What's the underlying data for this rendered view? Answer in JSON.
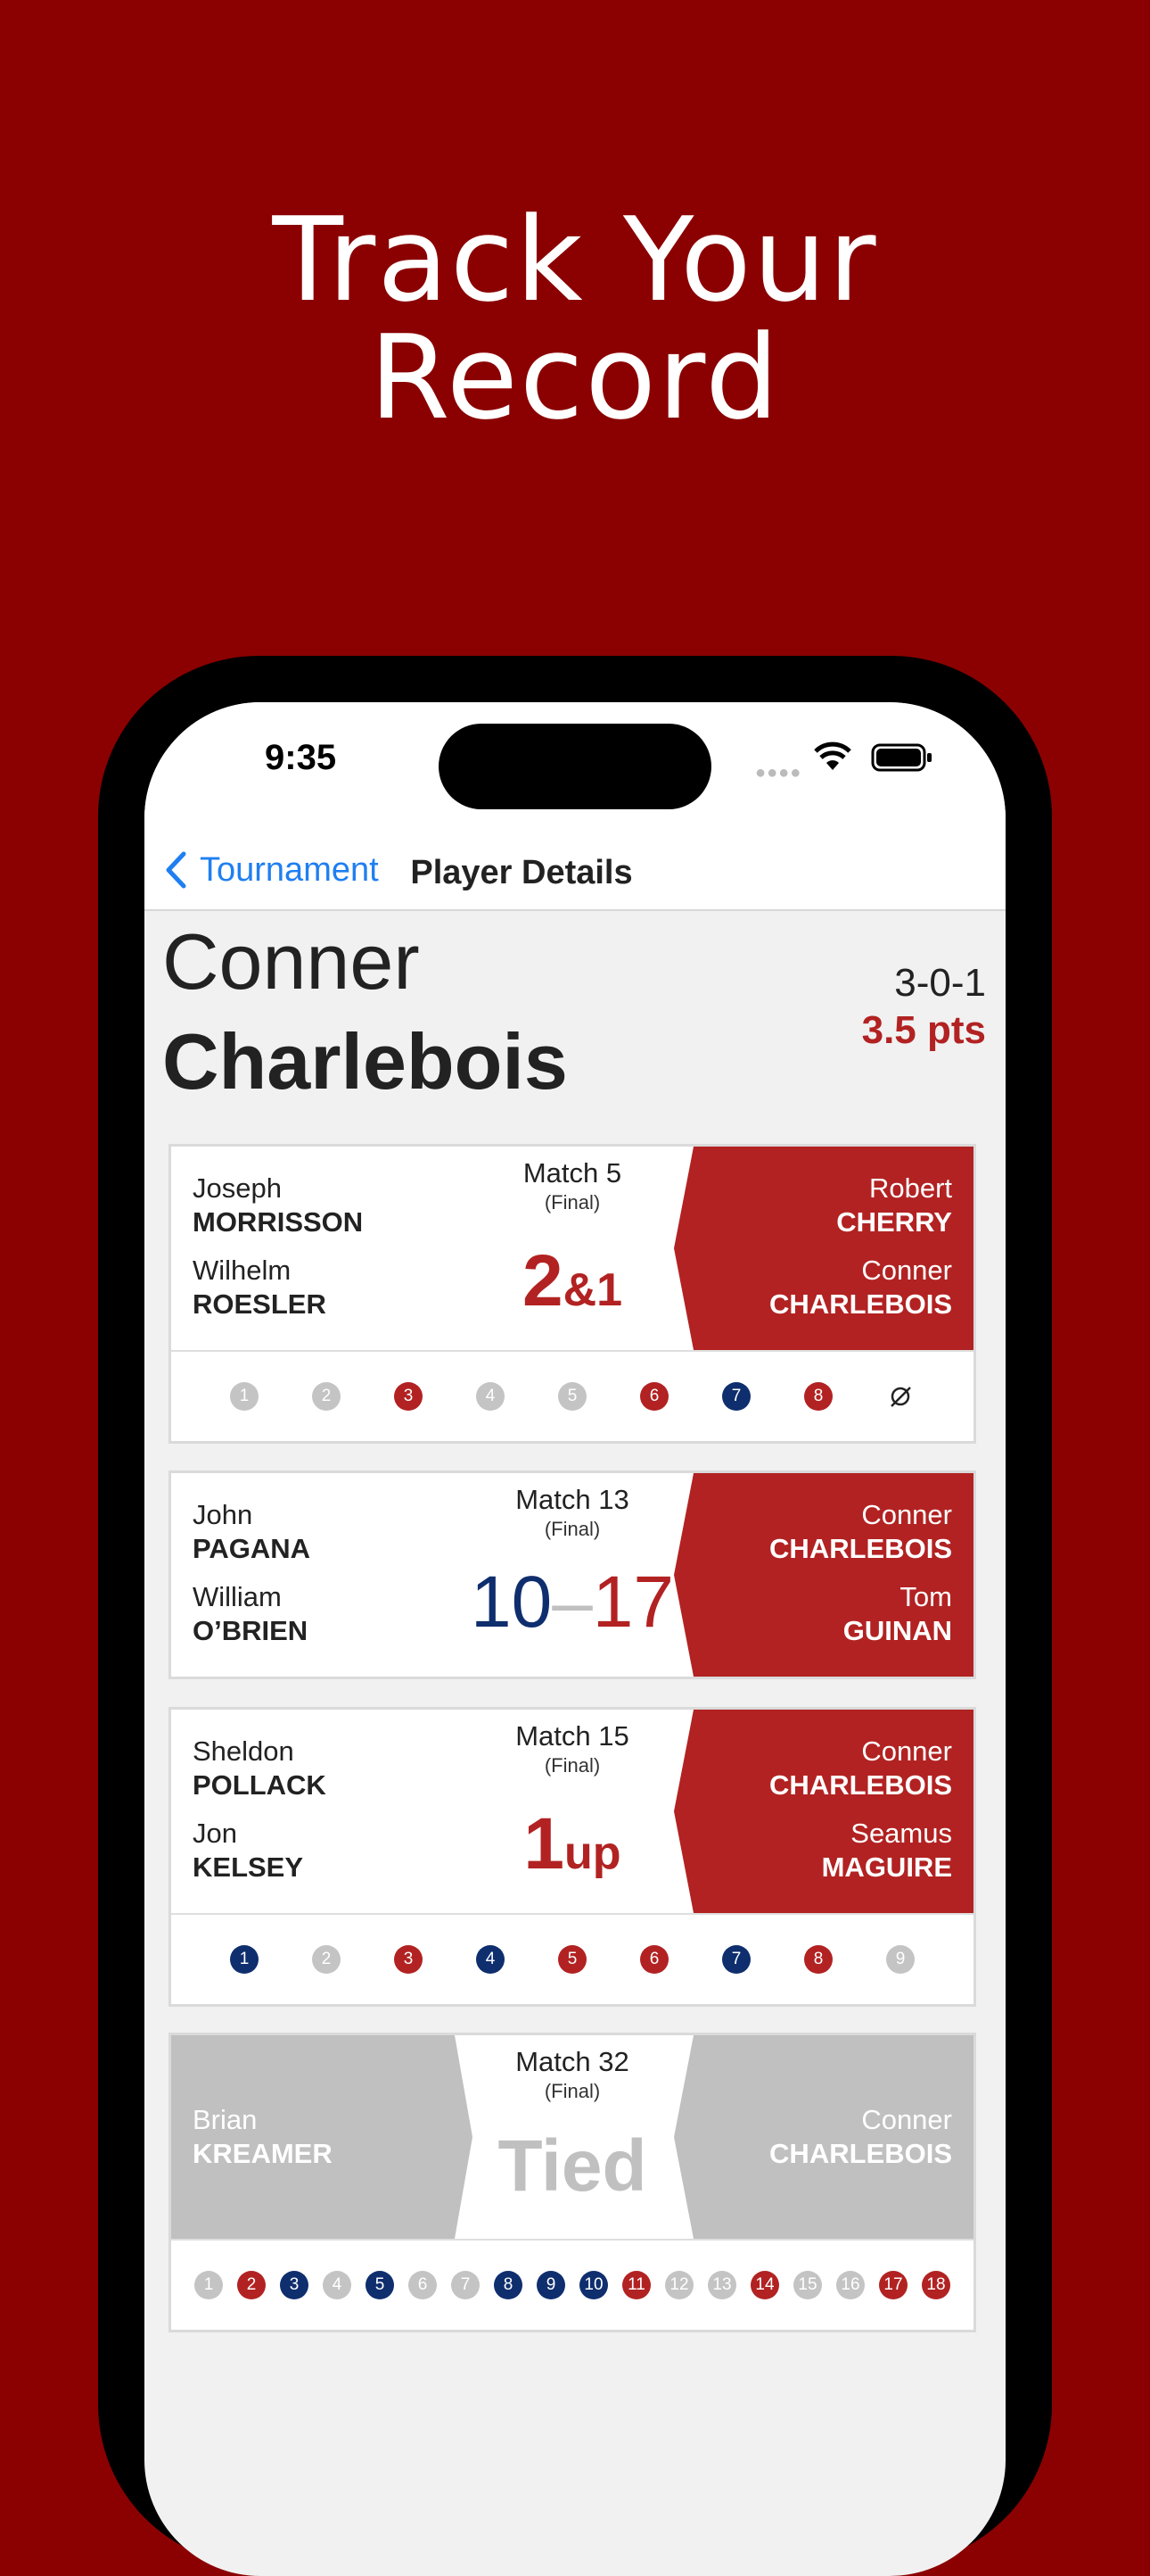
{
  "headline": {
    "line1": "Track Your",
    "line2": "Record"
  },
  "status_bar": {
    "time": "9:35"
  },
  "nav": {
    "back_label": "Tournament",
    "title": "Player Details"
  },
  "player": {
    "first_name": "Conner",
    "last_name": "Charlebois",
    "record": "3-0-1",
    "points": "3.5 pts"
  },
  "colors": {
    "background": "#8b0101",
    "red": "#b22222",
    "navy": "#0f2e6e",
    "gray": "#c0c0c0",
    "link": "#1f7ff1"
  },
  "matches": [
    {
      "title": "Match 5",
      "status": "(Final)",
      "result_main": "2",
      "result_sub": "&1",
      "left_players": [
        {
          "first": "Joseph",
          "last": "MORRISSON"
        },
        {
          "first": "Wilhelm",
          "last": "ROESLER"
        }
      ],
      "right_players": [
        {
          "first": "Robert",
          "last": "CHERRY"
        },
        {
          "first": "Conner",
          "last": "CHARLEBOIS"
        }
      ],
      "holes": [
        {
          "n": "1",
          "c": "gray"
        },
        {
          "n": "2",
          "c": "gray"
        },
        {
          "n": "3",
          "c": "red"
        },
        {
          "n": "4",
          "c": "gray"
        },
        {
          "n": "5",
          "c": "gray"
        },
        {
          "n": "6",
          "c": "red"
        },
        {
          "n": "7",
          "c": "blue"
        },
        {
          "n": "8",
          "c": "red"
        },
        {
          "n": "9",
          "c": "none",
          "icon": "not-played-icon"
        }
      ]
    },
    {
      "title": "Match 13",
      "status": "(Final)",
      "score_left": "10",
      "score_sep": "–",
      "score_right": "17",
      "left_players": [
        {
          "first": "John",
          "last": "PAGANA"
        },
        {
          "first": "William",
          "last": "O’BRIEN"
        }
      ],
      "right_players": [
        {
          "first": "Conner",
          "last": "CHARLEBOIS"
        },
        {
          "first": "Tom",
          "last": "GUINAN"
        }
      ]
    },
    {
      "title": "Match 15",
      "status": "(Final)",
      "result_main": "1",
      "result_sub": "up",
      "left_players": [
        {
          "first": "Sheldon",
          "last": "POLLACK"
        },
        {
          "first": "Jon",
          "last": "KELSEY"
        }
      ],
      "right_players": [
        {
          "first": "Conner",
          "last": "CHARLEBOIS"
        },
        {
          "first": "Seamus",
          "last": "MAGUIRE"
        }
      ],
      "holes": [
        {
          "n": "1",
          "c": "blue"
        },
        {
          "n": "2",
          "c": "gray"
        },
        {
          "n": "3",
          "c": "red"
        },
        {
          "n": "4",
          "c": "blue"
        },
        {
          "n": "5",
          "c": "red"
        },
        {
          "n": "6",
          "c": "red"
        },
        {
          "n": "7",
          "c": "blue"
        },
        {
          "n": "8",
          "c": "red"
        },
        {
          "n": "9",
          "c": "gray"
        }
      ]
    },
    {
      "title": "Match 32",
      "status": "(Final)",
      "result": "Tied",
      "left_players": [
        {
          "first": "Brian",
          "last": "KREAMER"
        }
      ],
      "right_players": [
        {
          "first": "Conner",
          "last": "CHARLEBOIS"
        }
      ],
      "holes": [
        {
          "n": "1",
          "c": "gray"
        },
        {
          "n": "2",
          "c": "red"
        },
        {
          "n": "3",
          "c": "blue"
        },
        {
          "n": "4",
          "c": "gray"
        },
        {
          "n": "5",
          "c": "blue"
        },
        {
          "n": "6",
          "c": "gray"
        },
        {
          "n": "7",
          "c": "gray"
        },
        {
          "n": "8",
          "c": "blue"
        },
        {
          "n": "9",
          "c": "blue"
        },
        {
          "n": "10",
          "c": "blue"
        },
        {
          "n": "11",
          "c": "red"
        },
        {
          "n": "12",
          "c": "gray"
        },
        {
          "n": "13",
          "c": "gray"
        },
        {
          "n": "14",
          "c": "red"
        },
        {
          "n": "15",
          "c": "gray"
        },
        {
          "n": "16",
          "c": "gray"
        },
        {
          "n": "17",
          "c": "red"
        },
        {
          "n": "18",
          "c": "red"
        }
      ]
    }
  ]
}
